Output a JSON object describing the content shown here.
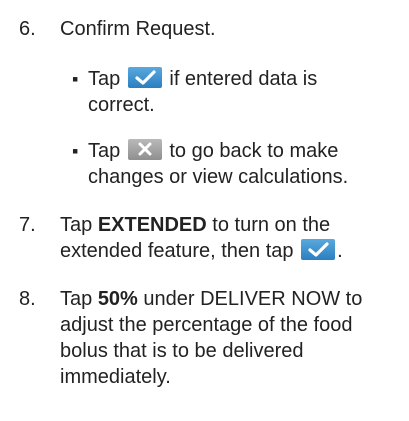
{
  "steps": [
    {
      "number": "6.",
      "text": "Confirm Request."
    },
    {
      "number": "7.",
      "bold": "EXTENDED",
      "text_a": "Tap ",
      "text_b": " to turn on the",
      "text_c": "extended feature, then tap ",
      "text_d": "."
    },
    {
      "number": "8.",
      "bold": "50%",
      "text_a": "Tap ",
      "text_b": " under DELIVER NOW to",
      "text_c": "adjust the percentage of the food",
      "text_d": "bolus that is to be delivered",
      "text_e": "immediately."
    }
  ],
  "bullets": [
    {
      "dot": "▪",
      "text_a": "Tap ",
      "text_b": " if entered data is",
      "text_c": "correct."
    },
    {
      "dot": "▪",
      "text_a": "Tap ",
      "text_b": " to go back to make",
      "text_c": "changes or view calculations."
    }
  ],
  "icons": {
    "confirm": "check-icon",
    "cancel": "x-icon",
    "confirm_color": "#3a8fd0",
    "cancel_color": "#a3a3a3"
  }
}
